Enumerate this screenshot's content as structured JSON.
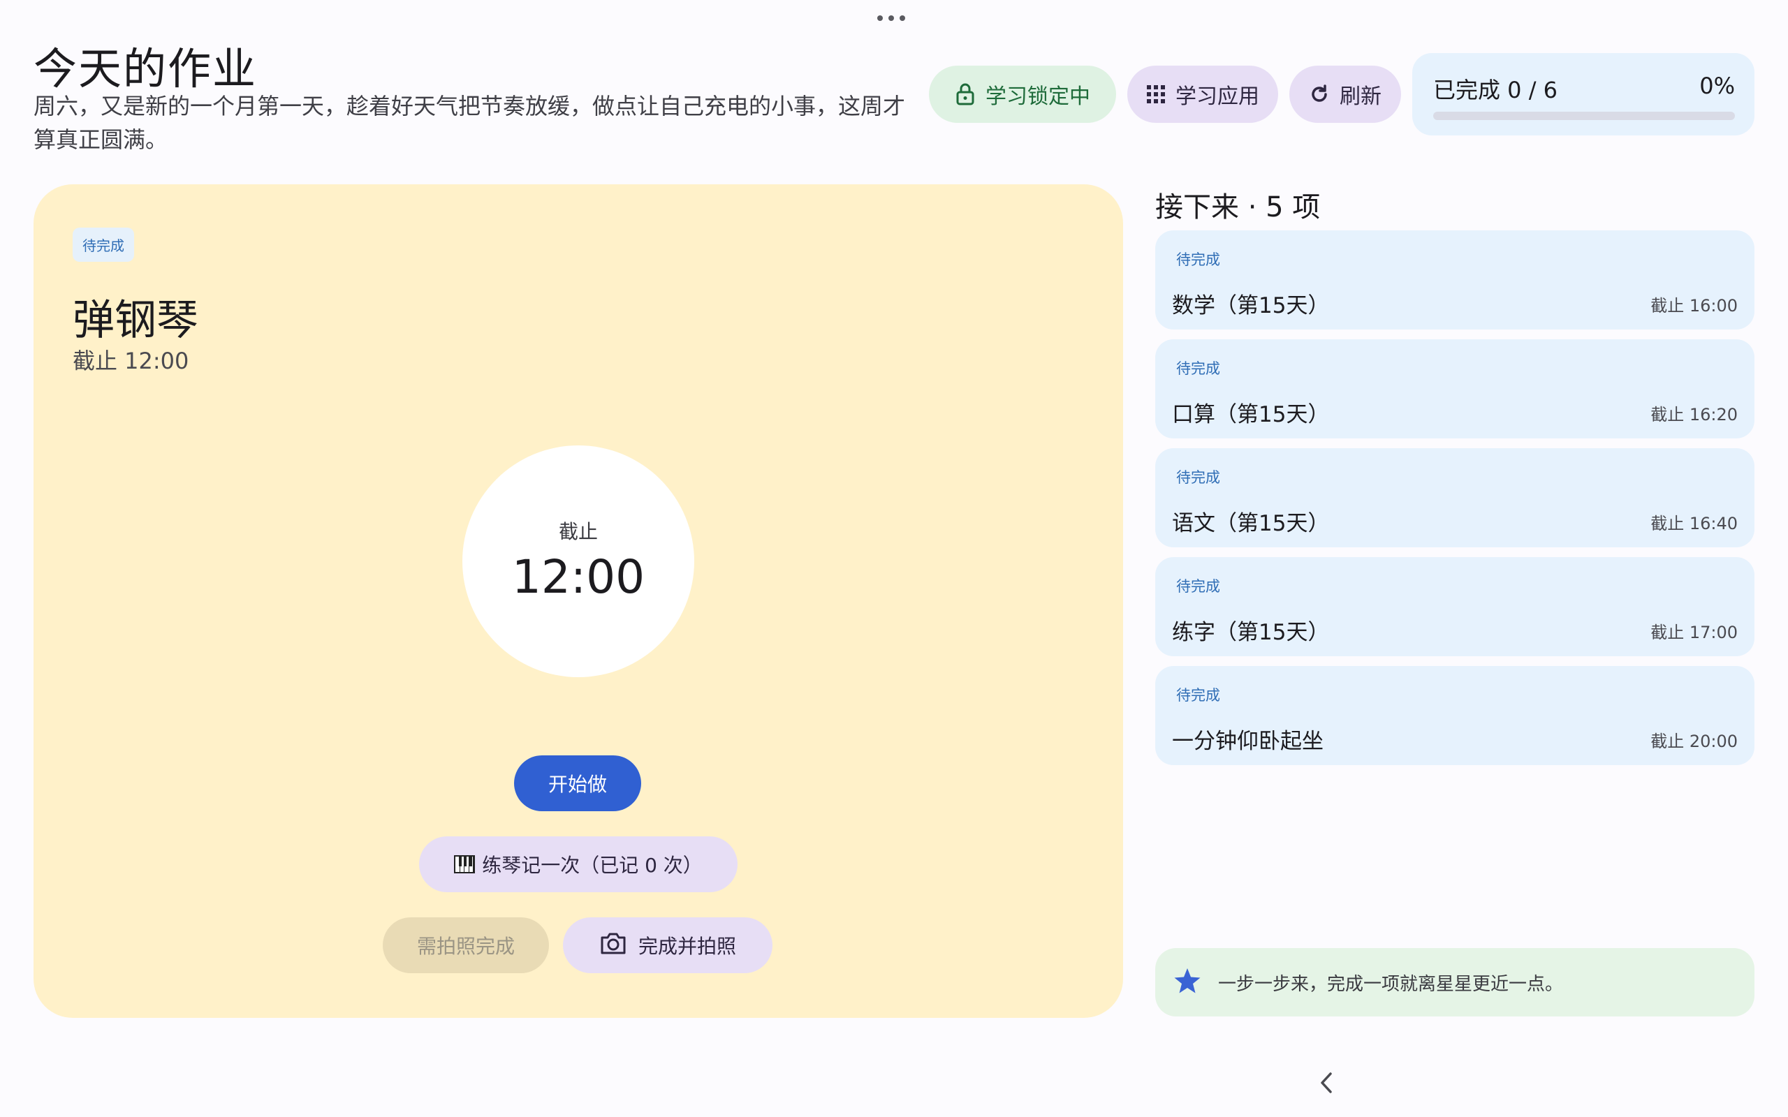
{
  "header": {
    "title": "今天的作业",
    "subtitle": "周六，又是新的一个月第一天，趁着好天气把节奏放缓，做点让自己充电的小事，这周才算真正圆满。"
  },
  "toolbar": {
    "lock_label": "学习锁定中",
    "apps_label": "学习应用",
    "refresh_label": "刷新"
  },
  "progress": {
    "label": "已完成 0 / 6",
    "percent_text": "0%",
    "fraction": 0
  },
  "current_task": {
    "status": "待完成",
    "title": "弹钢琴",
    "deadline": "截止 12:00",
    "clock_label": "截止",
    "clock_time": "12:00",
    "start_label": "开始做",
    "log_label": "练琴记一次（已记 0 次）",
    "photo_needed_label": "需拍照完成",
    "done_photo_label": "完成并拍照"
  },
  "next": {
    "header": "接下来 · 5 项",
    "items": [
      {
        "status": "待完成",
        "title": "数学（第15天）",
        "deadline": "截止 16:00"
      },
      {
        "status": "待完成",
        "title": "口算（第15天）",
        "deadline": "截止 16:20"
      },
      {
        "status": "待完成",
        "title": "语文（第15天）",
        "deadline": "截止 16:40"
      },
      {
        "status": "待完成",
        "title": "练字（第15天）",
        "deadline": "截止 17:00"
      },
      {
        "status": "待完成",
        "title": "一分钟仰卧起坐",
        "deadline": "截止 20:00"
      }
    ]
  },
  "tip": {
    "text": "一步一步来，完成一项就离星星更近一点。"
  },
  "icons": {
    "lock": "lock-icon",
    "apps": "grid-icon",
    "refresh": "refresh-icon",
    "piano": "piano-icon",
    "camera": "camera-icon",
    "star": "star-icon",
    "back": "chevron-left-icon",
    "more": "more-horizontal-icon"
  },
  "colors": {
    "accent": "#3060d2",
    "task_card": "#fff1c9",
    "list_card": "#e6f2fd",
    "lock_bg": "#dff2e3",
    "lock_fg": "#1e6b3a",
    "tonal_button": "#e7def5",
    "tip_bg": "#e5f4e6"
  }
}
